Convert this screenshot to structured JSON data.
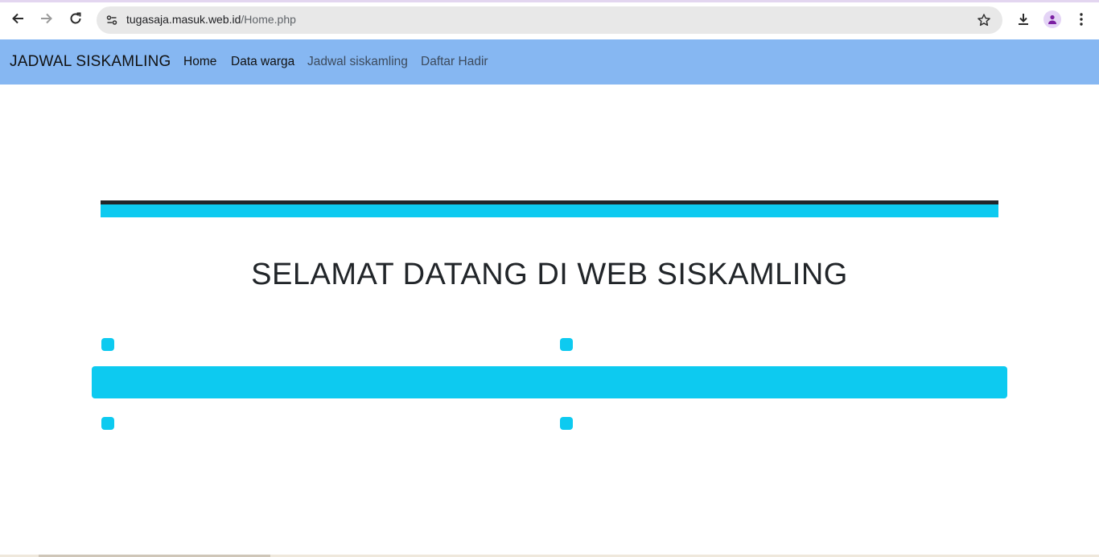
{
  "browser": {
    "url_host": "tugasaja.masuk.web.id",
    "url_path": "/Home.php",
    "icons": {
      "back": "back-arrow-icon",
      "forward": "forward-arrow-icon",
      "reload": "reload-icon",
      "site_info": "site-info-icon",
      "bookmark": "star-icon",
      "download": "download-icon",
      "profile": "profile-icon",
      "menu": "kebab-menu-icon"
    }
  },
  "navbar": {
    "brand": "JADWAL SISKAMLING",
    "links": [
      {
        "label": "Home"
      },
      {
        "label": "Data warga"
      },
      {
        "label": "Jadwal siskamling"
      },
      {
        "label": "Daftar Hadir"
      }
    ],
    "background": "#86b7f2"
  },
  "main": {
    "title": "SELAMAT DATANG DI WEB SISKAMLING"
  },
  "colors": {
    "accent": "#0dcaf0",
    "dark": "#212529"
  }
}
